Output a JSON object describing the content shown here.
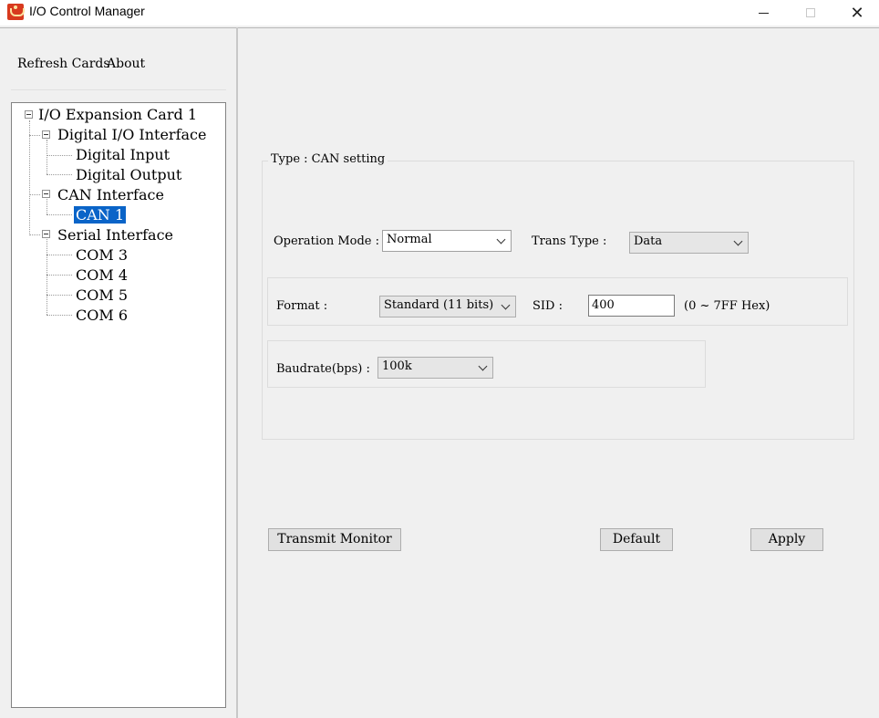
{
  "window": {
    "title": "I/O Control Manager",
    "minimize_icon": "minimize-icon",
    "maximize_icon": "maximize-icon",
    "close_glyph": "✕"
  },
  "menu": {
    "refresh": "Refresh Cards",
    "about": "About"
  },
  "tree": {
    "root": "I/O Expansion Card 1",
    "digital": "Digital I/O Interface",
    "digital_input": "Digital Input",
    "digital_output": "Digital Output",
    "can": "CAN Interface",
    "can1": "CAN 1",
    "serial": "Serial Interface",
    "com3": "COM 3",
    "com4": "COM 4",
    "com5": "COM 5",
    "com6": "COM 6"
  },
  "settings": {
    "group_title": "Type : CAN setting",
    "operation_mode_label": "Operation Mode :",
    "operation_mode_value": "Normal",
    "trans_type_label": "Trans Type :",
    "trans_type_value": "Data",
    "format_label": "Format :",
    "format_value": "Standard (11 bits)",
    "sid_label": "SID :",
    "sid_value": "400",
    "sid_hint": "(0 ~ 7FF Hex)",
    "baudrate_label": "Baudrate(bps) :",
    "baudrate_value": "100k"
  },
  "buttons": {
    "transmit_monitor": "Transmit Monitor",
    "default": "Default",
    "apply": "Apply"
  },
  "colors": {
    "selection": "#0a64c8",
    "panel_bg": "#f0f0f0"
  }
}
